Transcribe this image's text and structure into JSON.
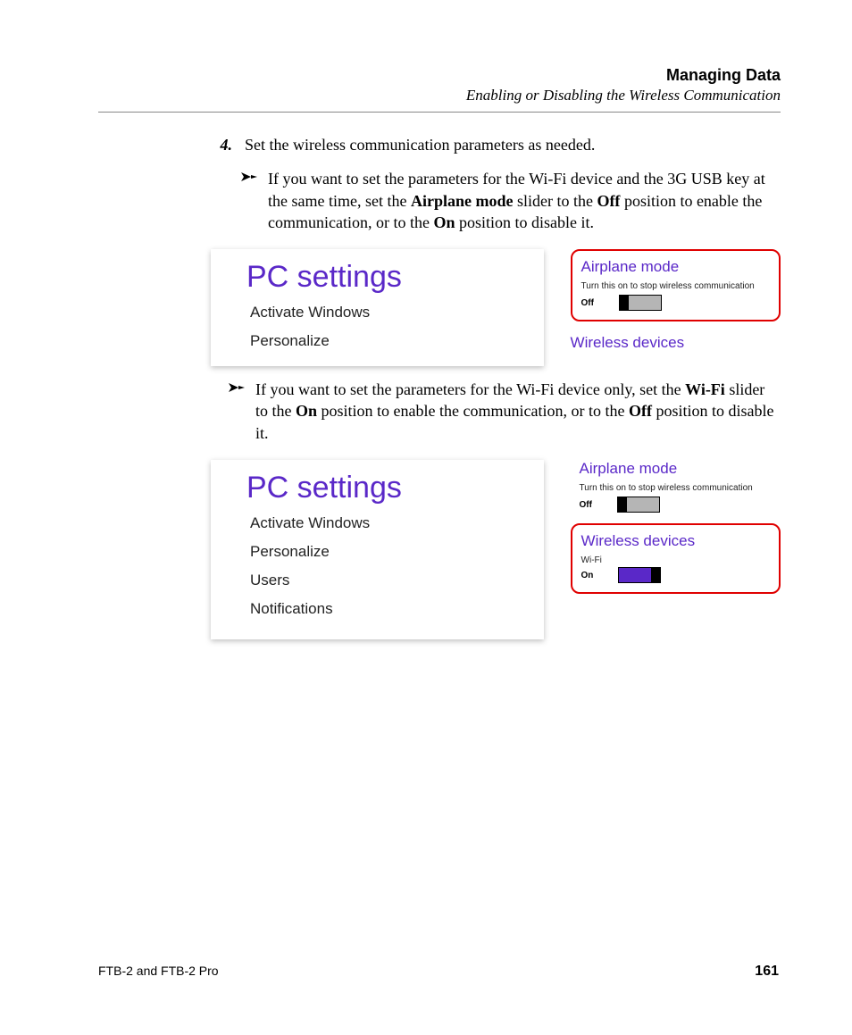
{
  "header": {
    "title": "Managing Data",
    "subtitle": "Enabling or Disabling the Wireless Communication"
  },
  "step": {
    "num": "4.",
    "text": "Set the wireless communication parameters as needed."
  },
  "bullets": {
    "a": {
      "t1": "If you want to set the parameters for the Wi-Fi device and the 3G USB key at the same time, set the ",
      "b1": "Airplane mode",
      "t2": " slider to the ",
      "b2": "Off",
      "t3": " position to enable the communication, or to the ",
      "b3": "On",
      "t4": " position to disable it."
    },
    "b": {
      "t1": "If you want to set the parameters for the Wi-Fi device only, set the ",
      "b1": "Wi-Fi",
      "t2": " slider to the ",
      "b2": "On",
      "t3": " position to enable the communication, or to the ",
      "b3": "Off",
      "t4": " position to disable it."
    }
  },
  "shot1": {
    "pc_title": "PC settings",
    "items": [
      "Activate Windows",
      "Personalize"
    ],
    "airplane_head": "Airplane mode",
    "airplane_desc": "Turn this on to stop wireless communication",
    "airplane_state": "Off",
    "wireless_head": "Wireless devices"
  },
  "shot2": {
    "pc_title": "PC settings",
    "items": [
      "Activate Windows",
      "Personalize",
      "Users",
      "Notifications"
    ],
    "airplane_head": "Airplane mode",
    "airplane_desc": "Turn this on to stop wireless communication",
    "airplane_state": "Off",
    "wireless_head": "Wireless devices",
    "wifi_label": "Wi-Fi",
    "wifi_state": "On"
  },
  "footer": {
    "left": "FTB-2 and FTB-2 Pro",
    "page": "161"
  }
}
